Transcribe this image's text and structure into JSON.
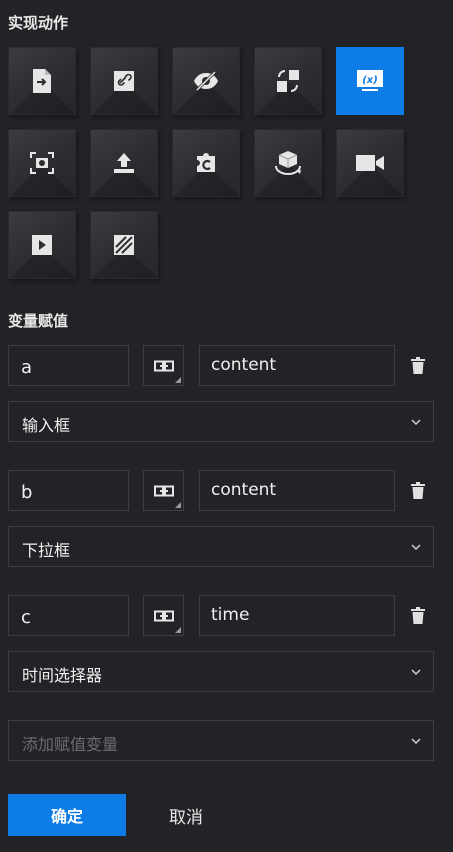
{
  "actions_section": {
    "title": "实现动作",
    "items": [
      {
        "icon": "page-jump-icon",
        "selected": false
      },
      {
        "icon": "link-icon",
        "selected": false
      },
      {
        "icon": "eye-off-icon",
        "selected": false
      },
      {
        "icon": "switch-icon",
        "selected": false
      },
      {
        "icon": "variable-icon",
        "selected": true,
        "label": "(x)"
      },
      {
        "icon": "screenshot-icon",
        "selected": false
      },
      {
        "icon": "upload-icon",
        "selected": false
      },
      {
        "icon": "plugin-icon",
        "selected": false
      },
      {
        "icon": "rotate-3d-icon",
        "selected": false
      },
      {
        "icon": "video-camera-icon",
        "selected": false
      },
      {
        "icon": "play-icon",
        "selected": false
      },
      {
        "icon": "texture-icon",
        "selected": false
      }
    ]
  },
  "variables_section": {
    "title": "变量赋值",
    "rows": [
      {
        "name": "a",
        "value": "content",
        "component": "输入框"
      },
      {
        "name": "b",
        "value": "content",
        "component": "下拉框"
      },
      {
        "name": "c",
        "value": "time",
        "component": "时间选择器"
      }
    ],
    "add_placeholder": "添加赋值变量"
  },
  "footer": {
    "confirm_label": "确定",
    "cancel_label": "取消"
  },
  "colors": {
    "background": "#222326",
    "accent": "#0d7ce6",
    "border": "#3d3e42"
  }
}
